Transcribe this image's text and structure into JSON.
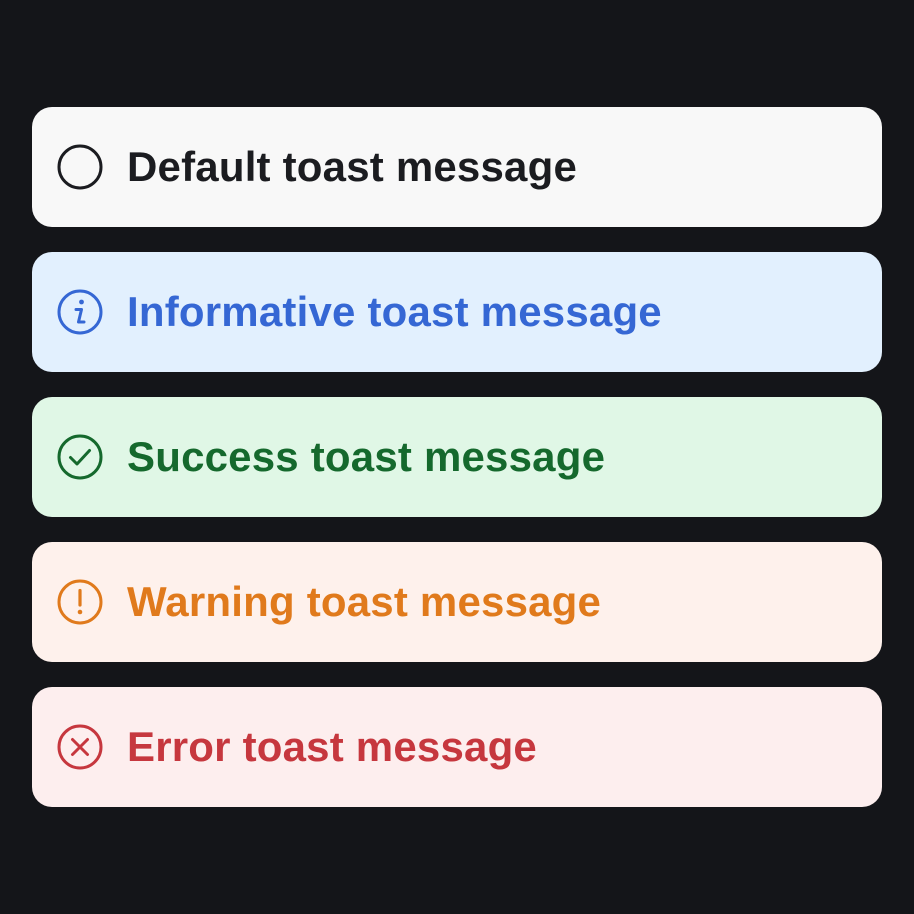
{
  "toasts": [
    {
      "variant": "default",
      "icon": "circle-icon",
      "message": "Default toast message",
      "color": "#1b1c20",
      "background": "#f8f8f8"
    },
    {
      "variant": "info",
      "icon": "info-icon",
      "message": "Informative toast message",
      "color": "#3567d4",
      "background": "#e2f0fe"
    },
    {
      "variant": "success",
      "icon": "check-circle-icon",
      "message": "Success toast message",
      "color": "#15692d",
      "background": "#e0f7e6"
    },
    {
      "variant": "warning",
      "icon": "exclamation-circle-icon",
      "message": "Warning toast message",
      "color": "#e07a1c",
      "background": "#fef1ec"
    },
    {
      "variant": "error",
      "icon": "x-circle-icon",
      "message": "Error toast message",
      "color": "#c6373e",
      "background": "#fdeeee"
    }
  ],
  "page_background": "#141519"
}
